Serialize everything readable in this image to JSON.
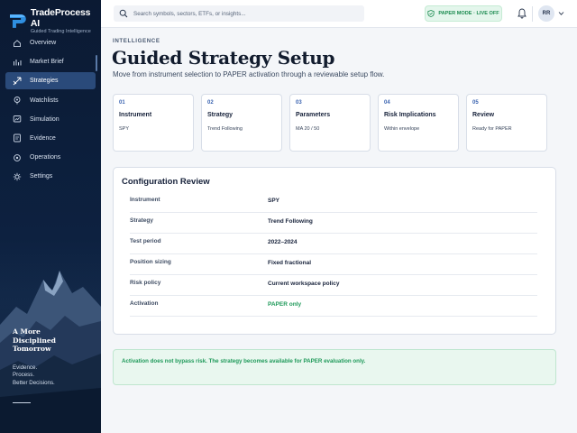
{
  "brand": {
    "name": "TradeProcess AI",
    "subtitle": "Guided Trading Intelligence"
  },
  "sidebar": {
    "items": [
      {
        "label": "Overview",
        "icon": "home-icon"
      },
      {
        "label": "Market Brief",
        "icon": "chart-icon"
      },
      {
        "label": "Strategies",
        "icon": "strategy-icon",
        "active": true
      },
      {
        "label": "Watchlists",
        "icon": "eye-icon"
      },
      {
        "label": "Simulation",
        "icon": "simulation-icon"
      },
      {
        "label": "Evidence",
        "icon": "evidence-icon"
      },
      {
        "label": "Operations",
        "icon": "operations-icon"
      },
      {
        "label": "Settings",
        "icon": "settings-icon"
      }
    ],
    "tagline": [
      "A More",
      "Disciplined",
      "Tomorrow"
    ],
    "tagline2": [
      "Evidence.",
      "Process.",
      "Better Decisions."
    ]
  },
  "header": {
    "search_placeholder": "Search symbols, sectors, ETFs, or insights...",
    "mode_badge": "PAPER MODE · LIVE OFF",
    "avatar_initials": "RR"
  },
  "main": {
    "eyebrow": "INTELLIGENCE",
    "title": "Guided Strategy Setup",
    "subtitle": "Move from instrument selection to PAPER activation through a reviewable setup flow.",
    "steps": [
      {
        "num": "01",
        "name": "Instrument",
        "value": "SPY"
      },
      {
        "num": "02",
        "name": "Strategy",
        "value": "Trend Following"
      },
      {
        "num": "03",
        "name": "Parameters",
        "value": "MA 20 / 50"
      },
      {
        "num": "04",
        "name": "Risk Implications",
        "value": "Within envelope"
      },
      {
        "num": "05",
        "name": "Review",
        "value": "Ready for PAPER"
      }
    ],
    "review": {
      "title": "Configuration Review",
      "rows": [
        {
          "key": "Instrument",
          "value": "SPY"
        },
        {
          "key": "Strategy",
          "value": "Trend Following"
        },
        {
          "key": "Test period",
          "value": "2022–2024"
        },
        {
          "key": "Position sizing",
          "value": "Fixed fractional"
        },
        {
          "key": "Risk policy",
          "value": "Current workspace policy"
        },
        {
          "key": "Activation",
          "value": "PAPER only"
        }
      ]
    },
    "notice": "Activation does not bypass risk. The strategy becomes available for PAPER evaluation only."
  },
  "colors": {
    "sidebar_bg": "#0b1a33",
    "active_item": "#2a4a7a",
    "accent_blue": "#3a63b0",
    "success_green": "#1f9a5a"
  }
}
